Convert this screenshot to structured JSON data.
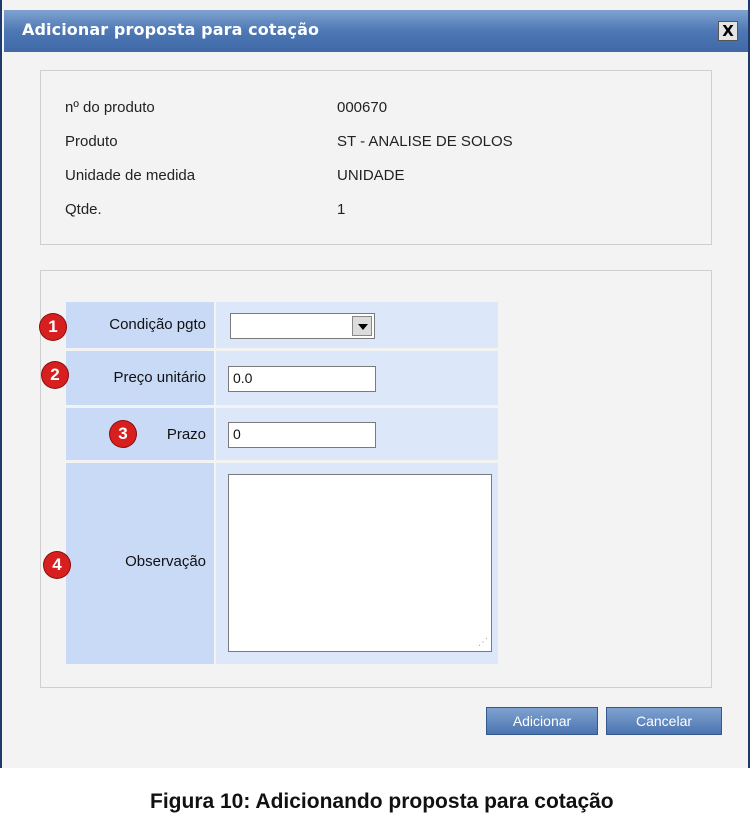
{
  "dialog": {
    "title": "Adicionar proposta para cotação",
    "close_label": "X"
  },
  "product_info": {
    "rows": [
      {
        "label": "nº do produto",
        "value": "000670"
      },
      {
        "label": "Produto",
        "value": "ST - ANALISE DE SOLOS"
      },
      {
        "label": "Unidade de medida",
        "value": "UNIDADE"
      },
      {
        "label": "Qtde.",
        "value": "1"
      }
    ]
  },
  "form": {
    "fields": [
      {
        "badge": "1",
        "label": "Condição pgto",
        "value": ""
      },
      {
        "badge": "2",
        "label": "Preço unitário",
        "value": "0.0"
      },
      {
        "badge": "3",
        "label": "Prazo",
        "value": "0"
      },
      {
        "badge": "4",
        "label": "Observação",
        "value": ""
      }
    ]
  },
  "buttons": {
    "add": "Adicionar",
    "cancel": "Cancelar"
  },
  "caption": "Figura 10: Adicionando proposta para cotação",
  "colors": {
    "titlebar": "#4e78b4",
    "label_cell": "#c8daf5",
    "badge": "#d81f1f"
  }
}
